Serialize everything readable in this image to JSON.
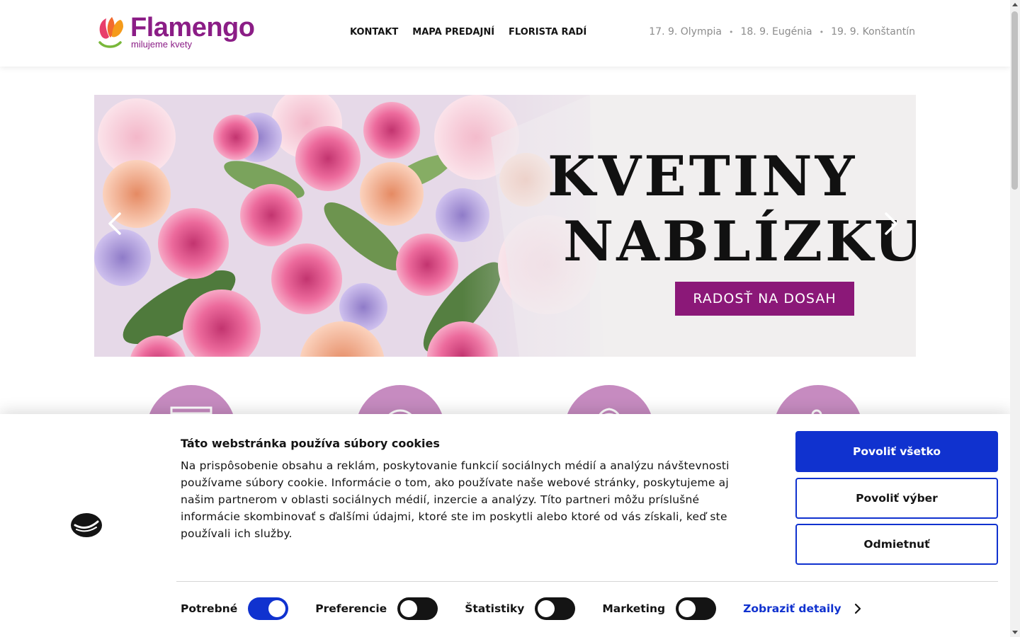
{
  "header": {
    "logo_name": "Flamengo",
    "logo_tagline": "milujeme kvety",
    "nav": [
      {
        "label": "KONTAKT"
      },
      {
        "label": "MAPA PREDAJNÍ"
      },
      {
        "label": "FLORISTA RADÍ"
      }
    ],
    "namedays": [
      {
        "label": "17. 9. Olympia"
      },
      {
        "label": "18. 9. Eugénia"
      },
      {
        "label": "19. 9. Konštantín"
      }
    ],
    "separator": "•"
  },
  "hero": {
    "line1": "KVETINY",
    "line2": "NABLÍZKU",
    "cta": "RADOSŤ NA DOSAH"
  },
  "cookie": {
    "title": "Táto webstránka používa súbory cookies",
    "text": "Na prispôsobenie obsahu a reklám, poskytovanie funkcií sociálnych médií a analýzu návštevnosti používame súbory cookie. Informácie o tom, ako používate naše webové stránky, poskytujeme aj našim partnerom v oblasti sociálnych médií, inzercie a analýzy. Títo partneri môžu príslušné informácie skombinovať s ďalšími údajmi, ktoré ste im poskytli alebo ktoré od vás získali, keď ste používali ich služby.",
    "buttons": {
      "allow_all": "Povoliť všetko",
      "allow_selection": "Povoliť výber",
      "deny": "Odmietnuť"
    },
    "toggles": [
      {
        "label": "Potrebné",
        "on": true
      },
      {
        "label": "Preferencie",
        "on": false
      },
      {
        "label": "Štatistiky",
        "on": false
      },
      {
        "label": "Marketing",
        "on": false
      }
    ],
    "details_link": "Zobraziť detaily"
  },
  "colors": {
    "brand": "#8b1d86",
    "accent": "#1032cf",
    "circle": "#c68bc0"
  },
  "icons": [
    "tulip-logo-icon",
    "chevron-left-icon",
    "chevron-right-icon",
    "cookiebot-logo-icon",
    "chevron-right-small-icon"
  ]
}
